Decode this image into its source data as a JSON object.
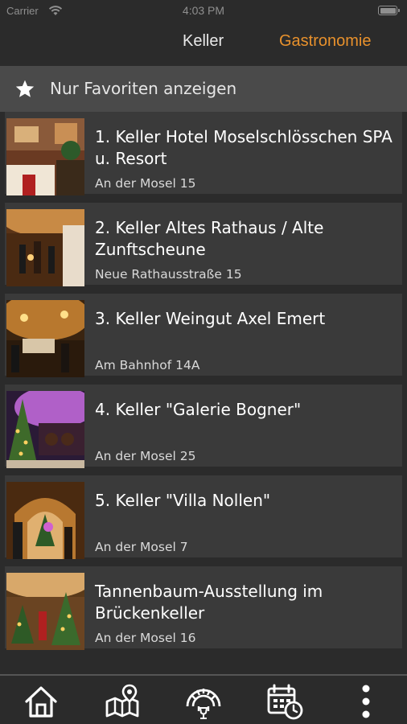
{
  "status_bar": {
    "carrier": "Carrier",
    "time": "4:03 PM"
  },
  "top_tabs": {
    "keller": "Keller",
    "gastronomie": "Gastronomie",
    "active": "Gastronomie",
    "active_color": "#e8912c"
  },
  "favorites_bar": {
    "label": "Nur Favoriten anzeigen",
    "icon": "star-icon"
  },
  "items": [
    {
      "name": "1. Keller Hotel Moselschlösschen SPA u. Resort",
      "address": "An der Mosel 15"
    },
    {
      "name": "2. Keller Altes Rathaus / Alte Zunftscheune",
      "address": "Neue Rathausstraße 15"
    },
    {
      "name": "3. Keller Weingut Axel Emert",
      "address": "Am Bahnhof 14A"
    },
    {
      "name": "4. Keller \"Galerie Bogner\"",
      "address": "An der Mosel 25"
    },
    {
      "name": "5. Keller \"Villa Nollen\"",
      "address": "An der Mosel 7"
    },
    {
      "name": "Tannenbaum-Ausstellung im Brückenkeller",
      "address": "An der Mosel 16"
    }
  ],
  "bottom_nav": [
    "home-icon",
    "map-icon",
    "wine-tasting-icon",
    "calendar-icon",
    "more-icon"
  ],
  "colors": {
    "background": "#2b2b2b",
    "card": "#3a3a3a",
    "accent": "#e8912c",
    "favorites_bar": "#4a4a4a"
  }
}
